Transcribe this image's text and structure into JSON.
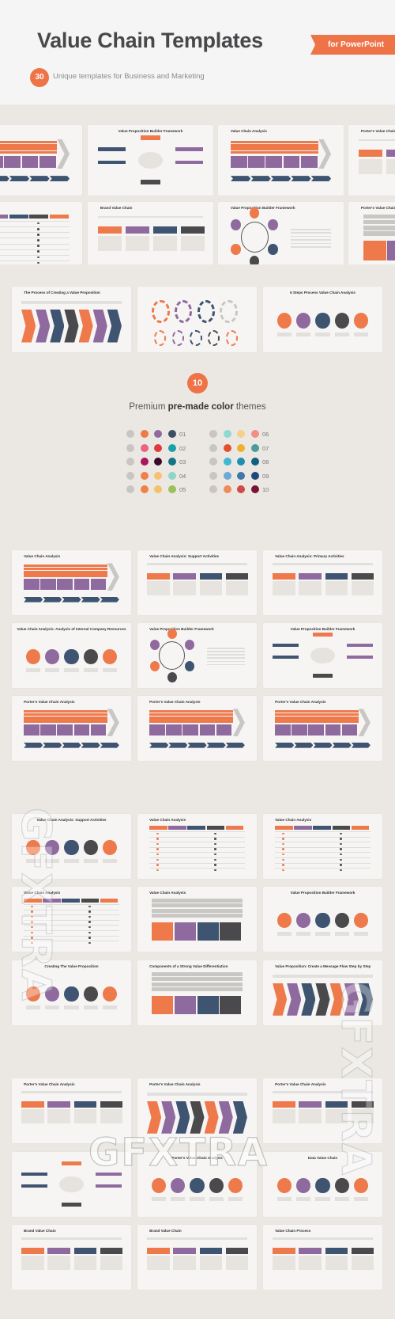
{
  "header": {
    "title": "Value Chain Templates",
    "ribbon": "for PowerPoint",
    "count_badge": "30",
    "subtitle": "Unique templates for Business and Marketing"
  },
  "themes": {
    "count_badge": "10",
    "heading_pre": "Premium",
    "heading_bold": "pre-made color",
    "heading_post": "themes",
    "items": [
      {
        "label": "01",
        "colors": [
          "#c8c5c2",
          "#ee7a47",
          "#8e6a9e",
          "#3d4f63"
        ]
      },
      {
        "label": "02",
        "colors": [
          "#c8c5c2",
          "#e86480",
          "#e03a3e",
          "#1aa0a8"
        ]
      },
      {
        "label": "03",
        "colors": [
          "#c8c5c2",
          "#a8185e",
          "#3a0a28",
          "#157383"
        ]
      },
      {
        "label": "04",
        "colors": [
          "#c8c5c2",
          "#f07f4e",
          "#f6c170",
          "#8fd4c6"
        ]
      },
      {
        "label": "05",
        "colors": [
          "#c8c5c2",
          "#ee8245",
          "#f4c06a",
          "#9cc058"
        ]
      },
      {
        "label": "06",
        "colors": [
          "#c8c5c2",
          "#8fd9d2",
          "#f6cf8f",
          "#ef8f86"
        ]
      },
      {
        "label": "07",
        "colors": [
          "#c8c5c2",
          "#e2502c",
          "#efb02f",
          "#4b9b9a"
        ]
      },
      {
        "label": "08",
        "colors": [
          "#c8c5c2",
          "#3fb8d2",
          "#1f8fb0",
          "#0f5f7e"
        ]
      },
      {
        "label": "09",
        "colors": [
          "#c8c5c2",
          "#6fa8d6",
          "#3f78a8",
          "#1d4a7a"
        ]
      },
      {
        "label": "10",
        "colors": [
          "#c8c5c2",
          "#ef8a5a",
          "#d04a4a",
          "#7a1238"
        ]
      }
    ]
  },
  "colors": {
    "orange": "#ee7a4c",
    "purple": "#8f6a9f",
    "navy": "#3e5470",
    "dark": "#4a4a4c",
    "gray": "#c9c7c3",
    "accent": "#ee7447"
  },
  "slides": {
    "top_rows": [
      {
        "title": "alysis",
        "kind": "chevron"
      },
      {
        "title": "Value Proposition Builder Framework",
        "kind": "framework"
      },
      {
        "title": "Value Chain Analysis",
        "kind": "chevron"
      },
      {
        "title": "Porter's Value Chain Analysis",
        "kind": "boxes"
      },
      {
        "title": "",
        "kind": "table"
      },
      {
        "title": "Brand Value Chain",
        "kind": "boxes"
      },
      {
        "title": "Value Proposition Builder Framework",
        "kind": "ring"
      },
      {
        "title": "Porter's Value Chain Ana",
        "kind": "bars"
      }
    ],
    "row_three": [
      {
        "title": "The Process of Creating a Value Proposition",
        "kind": "arrows"
      },
      {
        "title": "",
        "kind": "gears"
      },
      {
        "title": "6 Steps Process Value Chain Analysis",
        "kind": "circles"
      }
    ],
    "section_two": [
      {
        "title": "Value Chain Analysis",
        "kind": "chevron"
      },
      {
        "title": "Value Chain Analysis: Support Activities",
        "kind": "boxes"
      },
      {
        "title": "Value Chain Analysis: Primary Activities",
        "kind": "boxes"
      },
      {
        "title": "Value Chain Analysis: Analysis of Internal Company Resources",
        "kind": "circles"
      },
      {
        "title": "Value Proposition Builder Framework",
        "kind": "ring"
      },
      {
        "title": "Value Proposition Builder Framework",
        "kind": "framework"
      },
      {
        "title": "Porter's Value Chain Analysis",
        "kind": "chevron"
      },
      {
        "title": "Porter's Value Chain Analysis",
        "kind": "chevron"
      },
      {
        "title": "Porter's Value Chain Analysis",
        "kind": "chevron"
      }
    ],
    "section_three": [
      {
        "title": "Value Chain Analysis: Support Activities",
        "kind": "circles"
      },
      {
        "title": "Value Chain Analysis",
        "kind": "table"
      },
      {
        "title": "Value Chain Analysis",
        "kind": "table"
      },
      {
        "title": "Value Chain Analysis",
        "kind": "table"
      },
      {
        "title": "Value Chain Analysis",
        "kind": "bars"
      },
      {
        "title": "Value Proposition Builder Framework",
        "kind": "circles"
      },
      {
        "title": "Creating The Value Proposition",
        "kind": "circles"
      },
      {
        "title": "Components of a Strong Value Differentiation",
        "kind": "bars"
      },
      {
        "title": "Value Proposition: Create a Message Flow Step by Step",
        "kind": "arrows"
      }
    ],
    "section_four": [
      {
        "title": "Porter's Value Chain Analysis",
        "kind": "boxes"
      },
      {
        "title": "Porter's Value Chain Analysis",
        "kind": "arrows"
      },
      {
        "title": "Porter's Value Chain Analysis",
        "kind": "boxes"
      },
      {
        "title": "",
        "kind": "framework"
      },
      {
        "title": "Porter's Value Chain Analysis",
        "kind": "circles"
      },
      {
        "title": "Data Value Chain",
        "kind": "circles"
      },
      {
        "title": "Brand Value Chain",
        "kind": "boxes"
      },
      {
        "title": "Brand Value Chain",
        "kind": "boxes"
      },
      {
        "title": "Value Chain Process",
        "kind": "boxes"
      }
    ]
  },
  "watermark": "GFXTRA"
}
